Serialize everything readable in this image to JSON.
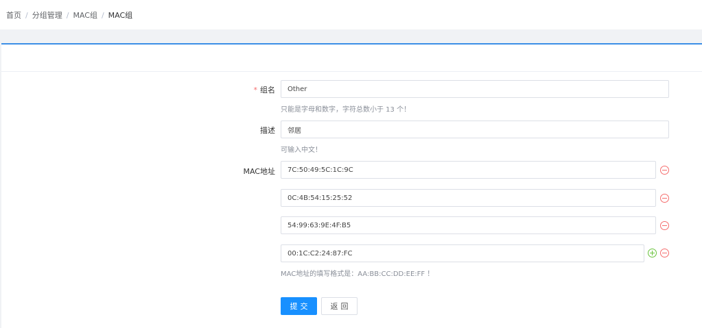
{
  "breadcrumb": {
    "items": [
      "首页",
      "分组管理",
      "MAC组"
    ],
    "current": "MAC组",
    "separator": "/"
  },
  "form": {
    "group_name": {
      "required_mark": "*",
      "label": "组名",
      "value": "Other",
      "hint": "只能是字母和数字，字符总数小于 13 个！"
    },
    "description": {
      "label": "描述",
      "value": "邻居",
      "hint": "可输入中文！"
    },
    "mac": {
      "label": "MAC地址",
      "values": [
        "7C:50:49:5C:1C:9C",
        "0C:4B:54:15:25:52",
        "54:99:63:9E:4F:B5",
        "00:1C:C2:24:87:FC"
      ],
      "hint": "MAC地址的填写格式是：AA:BB:CC:DD:EE:FF ！"
    },
    "submit_label": "提交",
    "back_label": "返回"
  },
  "colors": {
    "accent": "#1890ff",
    "panel_border": "#3a8ee6",
    "danger": "#f56c6c",
    "success": "#67c23a"
  },
  "icons": {
    "remove": "minus-circle-icon",
    "add": "plus-circle-icon"
  }
}
